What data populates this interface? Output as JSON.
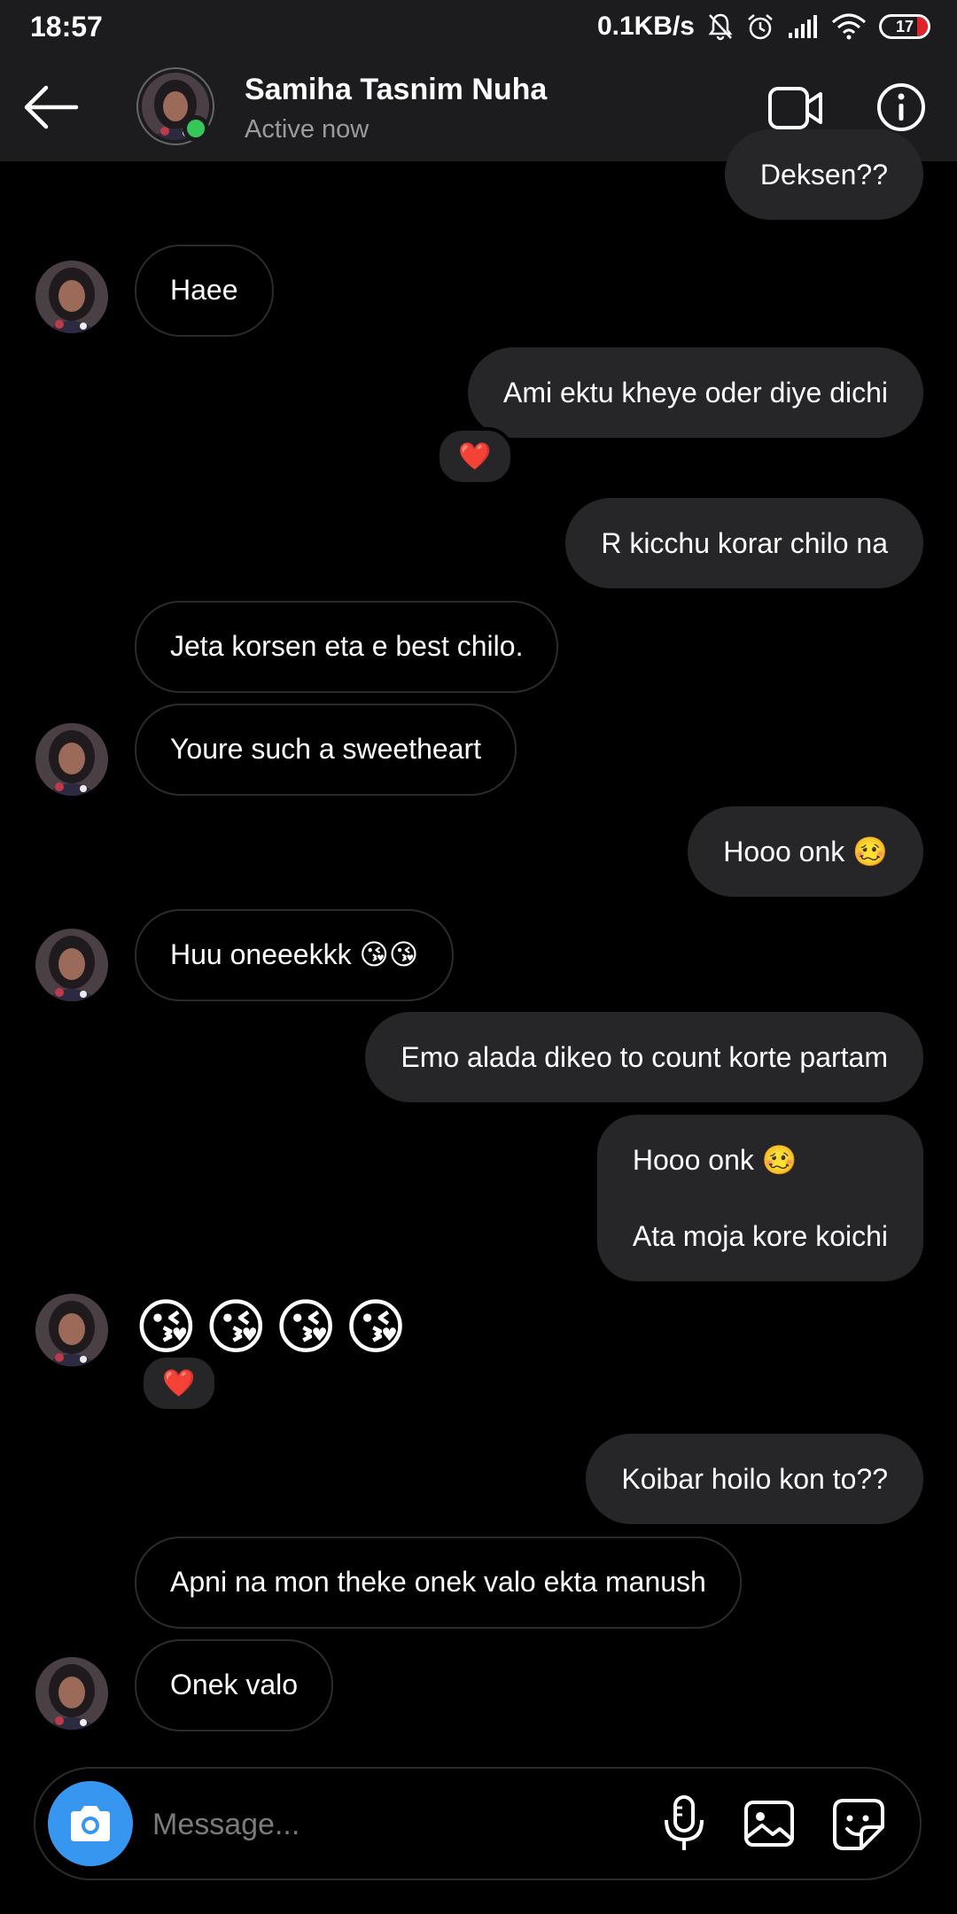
{
  "status_bar": {
    "time": "18:57",
    "net_speed": "0.1KB/s",
    "battery": "17"
  },
  "header": {
    "contact_name": "Samiha Tasnim Nuha",
    "contact_status": "Active now",
    "online_color": "#35c759"
  },
  "messages": [
    {
      "from": "me",
      "text": "Deksen??"
    },
    {
      "from": "them",
      "text": "Haee"
    },
    {
      "from": "me",
      "text": "Ami ektu kheye oder diye dichi",
      "reaction": "❤️"
    },
    {
      "from": "me",
      "text": "R kicchu korar chilo na"
    },
    {
      "from": "them",
      "text": "Jeta korsen eta e best chilo."
    },
    {
      "from": "them",
      "text": "Youre such a sweetheart"
    },
    {
      "from": "me",
      "text": "Hooo onk 🥴"
    },
    {
      "from": "them",
      "text": "Huu oneeekkk 😘😘"
    },
    {
      "from": "me",
      "text": "Emo alada dikeo to count korte partam"
    },
    {
      "from": "me",
      "lines": [
        "Hooo onk 🥴",
        "Ata moja kore koichi"
      ]
    },
    {
      "from": "them",
      "emojis": [
        "😘",
        "😘",
        "😘",
        "😘"
      ],
      "reaction": "❤️"
    },
    {
      "from": "me",
      "text": "Koibar hoilo kon to??"
    },
    {
      "from": "them",
      "text": "Apni na mon theke onek valo ekta manush"
    },
    {
      "from": "them",
      "text": "Onek valo"
    }
  ],
  "composer": {
    "placeholder": "Message...",
    "camera_color": "#3797f0"
  },
  "icons": [
    "back-arrow-icon",
    "video-camera-icon",
    "info-icon",
    "camera-icon",
    "microphone-icon",
    "gallery-icon",
    "sticker-icon"
  ]
}
